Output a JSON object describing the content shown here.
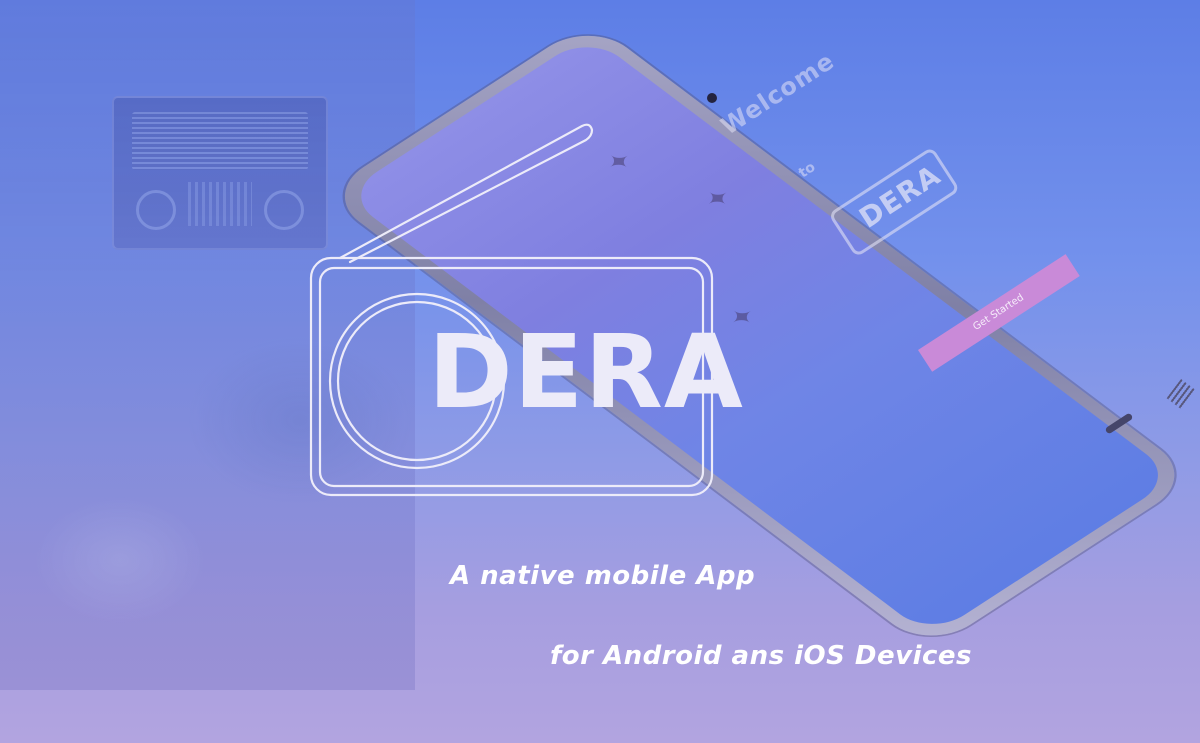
{
  "brand": {
    "logo_text": "DERA",
    "colors": {
      "background_top": "#5d7ee6",
      "background_bottom": "#b2a4e0",
      "logo_outline": "#ecebf9",
      "cta": "#c98ad8"
    }
  },
  "phone_screen": {
    "welcome_text": "Welcome",
    "to_text": "to",
    "logo_text": "DERA",
    "cta_label": "Get Started"
  },
  "taglines": {
    "line1": "A native mobile App",
    "line2": "for Android ans iOS Devices"
  },
  "icons": {
    "radio_logo": "radio-outline-icon",
    "bird": "bird-icon"
  }
}
